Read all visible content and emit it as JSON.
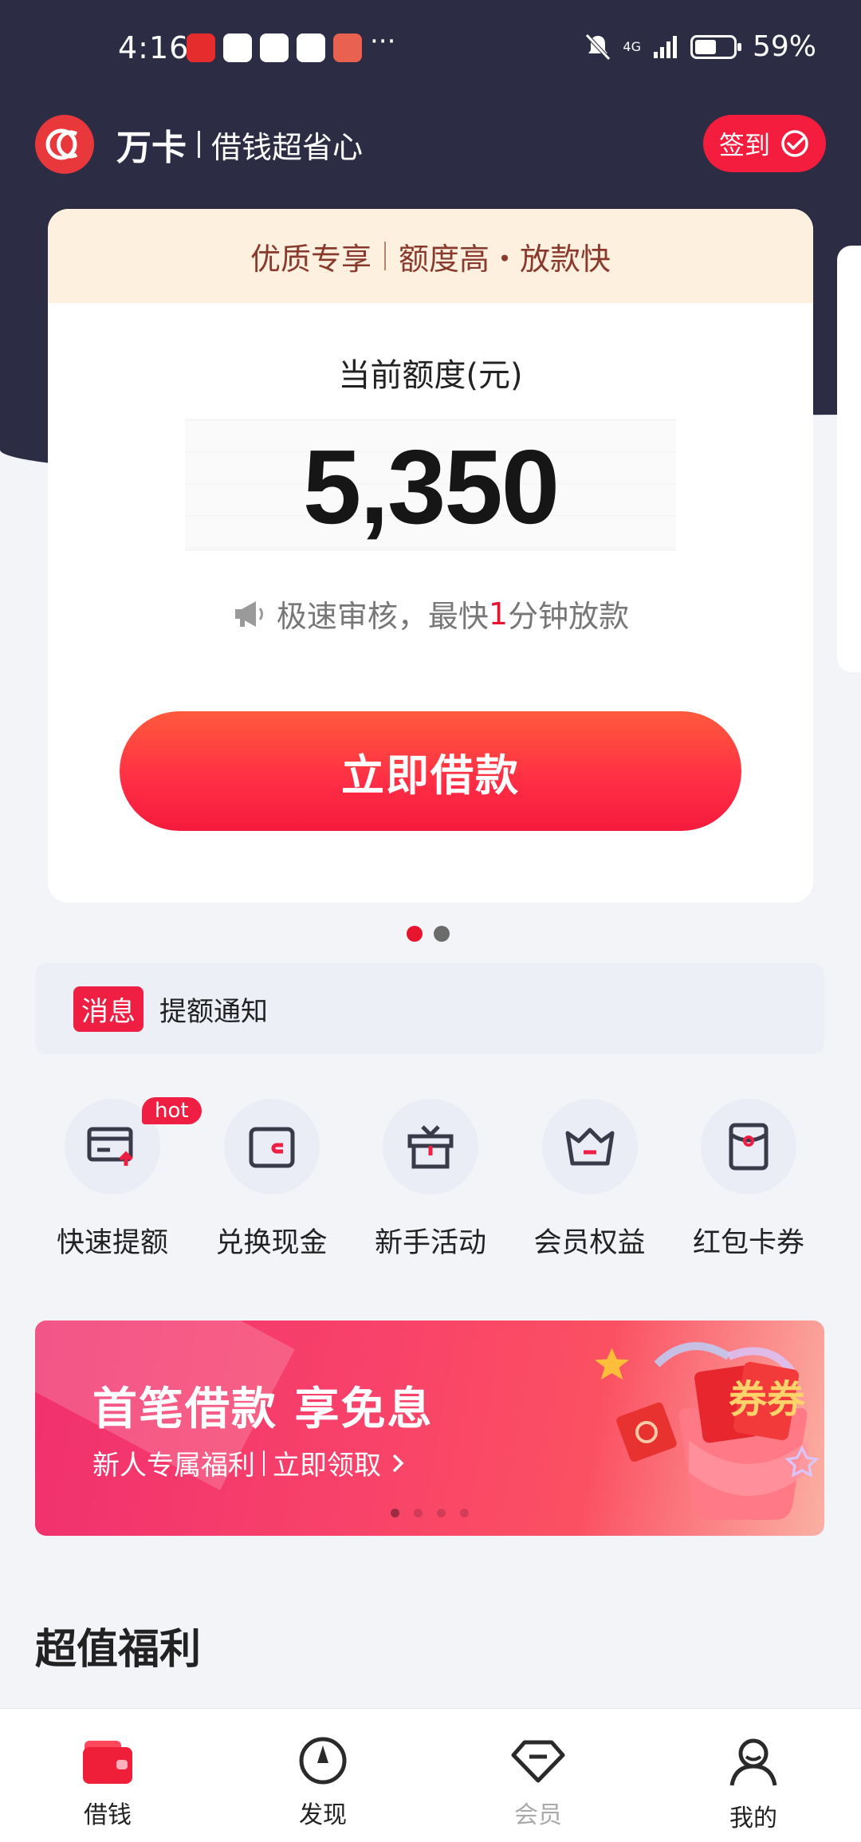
{
  "status_bar": {
    "time": "4:16",
    "signal": "4G",
    "battery": "59%"
  },
  "header": {
    "brand_name": "万卡",
    "slogan": "借钱超省心",
    "checkin_label": "签到"
  },
  "credit_card": {
    "banner_left": "优质专享",
    "banner_right": "额度高・放款快",
    "label": "当前额度(元)",
    "amount": "5,350",
    "notice_prefix": "极速审核，最快",
    "notice_highlight": "1",
    "notice_suffix": "分钟放款",
    "button_label": "立即借款"
  },
  "message": {
    "tag": "消息",
    "text": "提额通知"
  },
  "quick_menu": [
    {
      "label": "快速提额",
      "icon": "credit-up-icon",
      "badge": "hot"
    },
    {
      "label": "兑换现金",
      "icon": "wallet-icon"
    },
    {
      "label": "新手活动",
      "icon": "gift-icon"
    },
    {
      "label": "会员权益",
      "icon": "crown-icon"
    },
    {
      "label": "红包卡券",
      "icon": "red-packet-icon"
    }
  ],
  "promo": {
    "title": "首笔借款 享免息",
    "sub_left": "新人专属福利",
    "sub_right": "立即领取",
    "art_text": "券券"
  },
  "section_title": "超值福利",
  "bottom_nav": [
    {
      "label": "借钱",
      "icon": "wallet-icon",
      "active": true
    },
    {
      "label": "发现",
      "icon": "compass-icon"
    },
    {
      "label": "会员",
      "icon": "diamond-icon"
    },
    {
      "label": "我的",
      "icon": "user-icon"
    }
  ],
  "colors": {
    "accent": "#f51d3e",
    "header_bg": "#2c2c45",
    "page_bg": "#f3f4f8"
  }
}
